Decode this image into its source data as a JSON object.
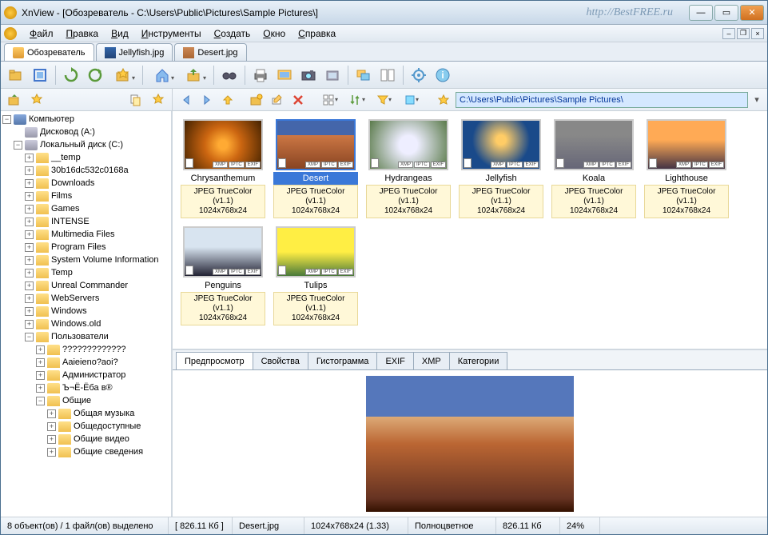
{
  "title": "XnView - [Обозреватель - C:\\Users\\Public\\Pictures\\Sample Pictures\\]",
  "watermark": "http://BestFREE.ru",
  "menu": [
    "Файл",
    "Правка",
    "Вид",
    "Инструменты",
    "Создать",
    "Окно",
    "Справка"
  ],
  "tabs": [
    {
      "label": "Обозреватель",
      "kind": "browser",
      "active": true
    },
    {
      "label": "Jellyfish.jpg",
      "kind": "img1",
      "active": false
    },
    {
      "label": "Desert.jpg",
      "kind": "img2",
      "active": false
    }
  ],
  "address": "C:\\Users\\Public\\Pictures\\Sample Pictures\\",
  "tree": {
    "root": "Компьютер",
    "drive_a": "Дисковод (A:)",
    "drive_c": "Локальный диск (C:)",
    "folders_c": [
      "__temp",
      "30b16dc532c0168a",
      "Downloads",
      "Films",
      "Games",
      "INTENSE",
      "Multimedia Files",
      "Program Files",
      "System Volume Information",
      "Temp",
      "Unreal Commander",
      "WebServers",
      "Windows",
      "Windows.old",
      "Пользователи"
    ],
    "users_sub": [
      "?????????????",
      "Aaieieno?aoi?",
      "Администратор",
      "Ъ¬Ё-Ёба в®",
      "Общие"
    ],
    "public_sub": [
      "Общая музыка",
      "Общедоступные",
      "Общие видео",
      "Общие сведения"
    ]
  },
  "thumbs": [
    {
      "name": "Chrysanthemum",
      "format": "JPEG TrueColor (v1.1)",
      "dims": "1024x768x24",
      "css": "chrys",
      "selected": false
    },
    {
      "name": "Desert",
      "format": "JPEG TrueColor (v1.1)",
      "dims": "1024x768x24",
      "css": "desert",
      "selected": true
    },
    {
      "name": "Hydrangeas",
      "format": "JPEG TrueColor (v1.1)",
      "dims": "1024x768x24",
      "css": "hydra",
      "selected": false
    },
    {
      "name": "Jellyfish",
      "format": "JPEG TrueColor (v1.1)",
      "dims": "1024x768x24",
      "css": "jelly",
      "selected": false
    },
    {
      "name": "Koala",
      "format": "JPEG TrueColor (v1.1)",
      "dims": "1024x768x24",
      "css": "koala",
      "selected": false
    },
    {
      "name": "Lighthouse",
      "format": "JPEG TrueColor (v1.1)",
      "dims": "1024x768x24",
      "css": "light",
      "selected": false
    },
    {
      "name": "Penguins",
      "format": "JPEG TrueColor (v1.1)",
      "dims": "1024x768x24",
      "css": "peng",
      "selected": false
    },
    {
      "name": "Tulips",
      "format": "JPEG TrueColor (v1.1)",
      "dims": "1024x768x24",
      "css": "tulips",
      "selected": false
    }
  ],
  "badges": [
    "XMP",
    "IPTC",
    "EXIF"
  ],
  "preview_tabs": [
    "Предпросмотр",
    "Свойства",
    "Гистограмма",
    "EXIF",
    "XMP",
    "Категории"
  ],
  "status": {
    "objects": "8 объект(ов) / 1 файл(ов) выделено",
    "size": "[ 826.11 Кб ]",
    "file": "Desert.jpg",
    "dims": "1024x768x24 (1.33)",
    "color": "Полноцветное",
    "filesize": "826.11 Кб",
    "zoom": "24%"
  }
}
